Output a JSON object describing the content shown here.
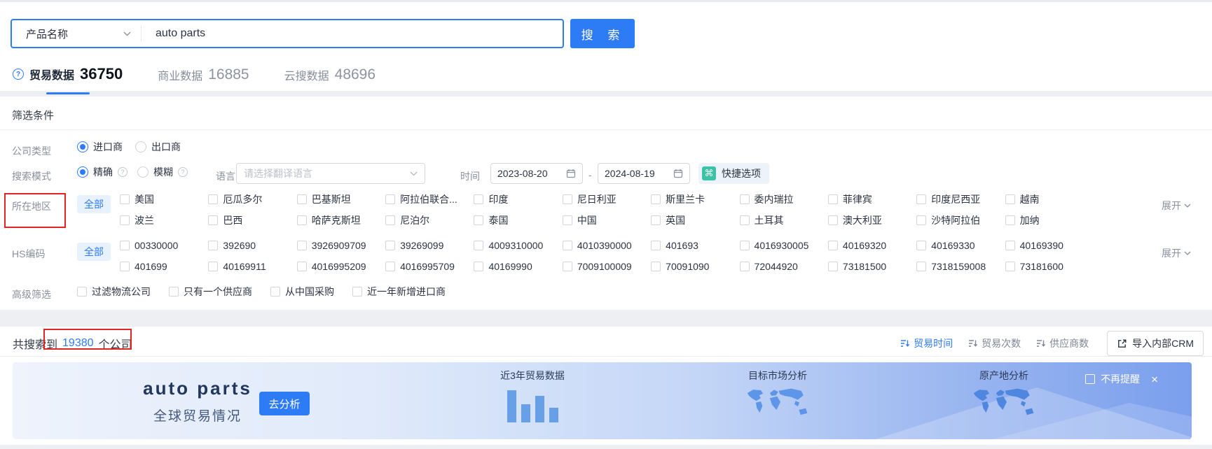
{
  "search": {
    "category_select": "产品名称",
    "query": "auto parts",
    "button_label": "搜 索"
  },
  "tabs": [
    {
      "label": "贸易数据",
      "count": "36750"
    },
    {
      "label": "商业数据",
      "count": "16885"
    },
    {
      "label": "云搜数据",
      "count": "48696"
    }
  ],
  "filters": {
    "title": "筛选条件",
    "company_type": {
      "label": "公司类型",
      "options": [
        {
          "label": "进口商"
        },
        {
          "label": "出口商"
        }
      ]
    },
    "search_mode": {
      "label": "搜索模式",
      "options": [
        {
          "label": "精确"
        },
        {
          "label": "模糊"
        }
      ]
    },
    "language": {
      "label": "语言",
      "placeholder": "请选择翻译语言"
    },
    "time": {
      "label": "时间",
      "start": "2023-08-20",
      "separator": "-",
      "end": "2024-08-19"
    },
    "quick_option": {
      "label": "快捷选项"
    },
    "region": {
      "label": "所在地区",
      "all_label": "全部",
      "row1": [
        "美国",
        "厄瓜多尔",
        "巴基斯坦",
        "阿拉伯联合...",
        "印度",
        "尼日利亚",
        "斯里兰卡",
        "委内瑞拉",
        "菲律宾",
        "印度尼西亚",
        "越南"
      ],
      "row2": [
        "波兰",
        "巴西",
        "哈萨克斯坦",
        "尼泊尔",
        "泰国",
        "中国",
        "英国",
        "土耳其",
        "澳大利亚",
        "沙特阿拉伯",
        "加纳"
      ],
      "expand_label": "展开"
    },
    "hs_code": {
      "label": "HS编码",
      "all_label": "全部",
      "row1": [
        "00330000",
        "392690",
        "3926909709",
        "39269099",
        "4009310000",
        "4010390000",
        "401693",
        "4016930005",
        "40169320",
        "40169330",
        "40169390"
      ],
      "row2": [
        "401699",
        "40169911",
        "4016995209",
        "4016995709",
        "40169990",
        "7009100009",
        "70091090",
        "72044920",
        "73181500",
        "7318159008",
        "73181600"
      ],
      "expand_label": "展开"
    },
    "advanced": {
      "label": "高级筛选",
      "options": [
        "过滤物流公司",
        "只有一个供应商",
        "从中国采购",
        "近一年新增进口商"
      ]
    }
  },
  "results": {
    "summary_prefix": "共搜索到",
    "summary_count": "19380",
    "summary_suffix": "个公司",
    "sorts": [
      {
        "label": "贸易时间",
        "active": true
      },
      {
        "label": "贸易次数",
        "active": false
      },
      {
        "label": "供应商数",
        "active": false
      }
    ],
    "crm_button": "导入内部CRM"
  },
  "banner": {
    "title": "auto parts",
    "subtitle": "全球贸易情况",
    "analyze_button": "去分析",
    "trade_chart": {
      "label": "近3年贸易数据",
      "bars": [
        46,
        26,
        38,
        21
      ]
    },
    "target_market": {
      "label": "目标市场分析"
    },
    "origin": {
      "label": "原产地分析"
    },
    "dismiss_label": "不再提醒",
    "close_glyph": "×"
  },
  "colors": {
    "primary_blue": "#2e7bf6",
    "teal_icon": "#3cc3a7",
    "annotation_red": "#e12424",
    "banner_bar_blue": "#68a0e7"
  }
}
